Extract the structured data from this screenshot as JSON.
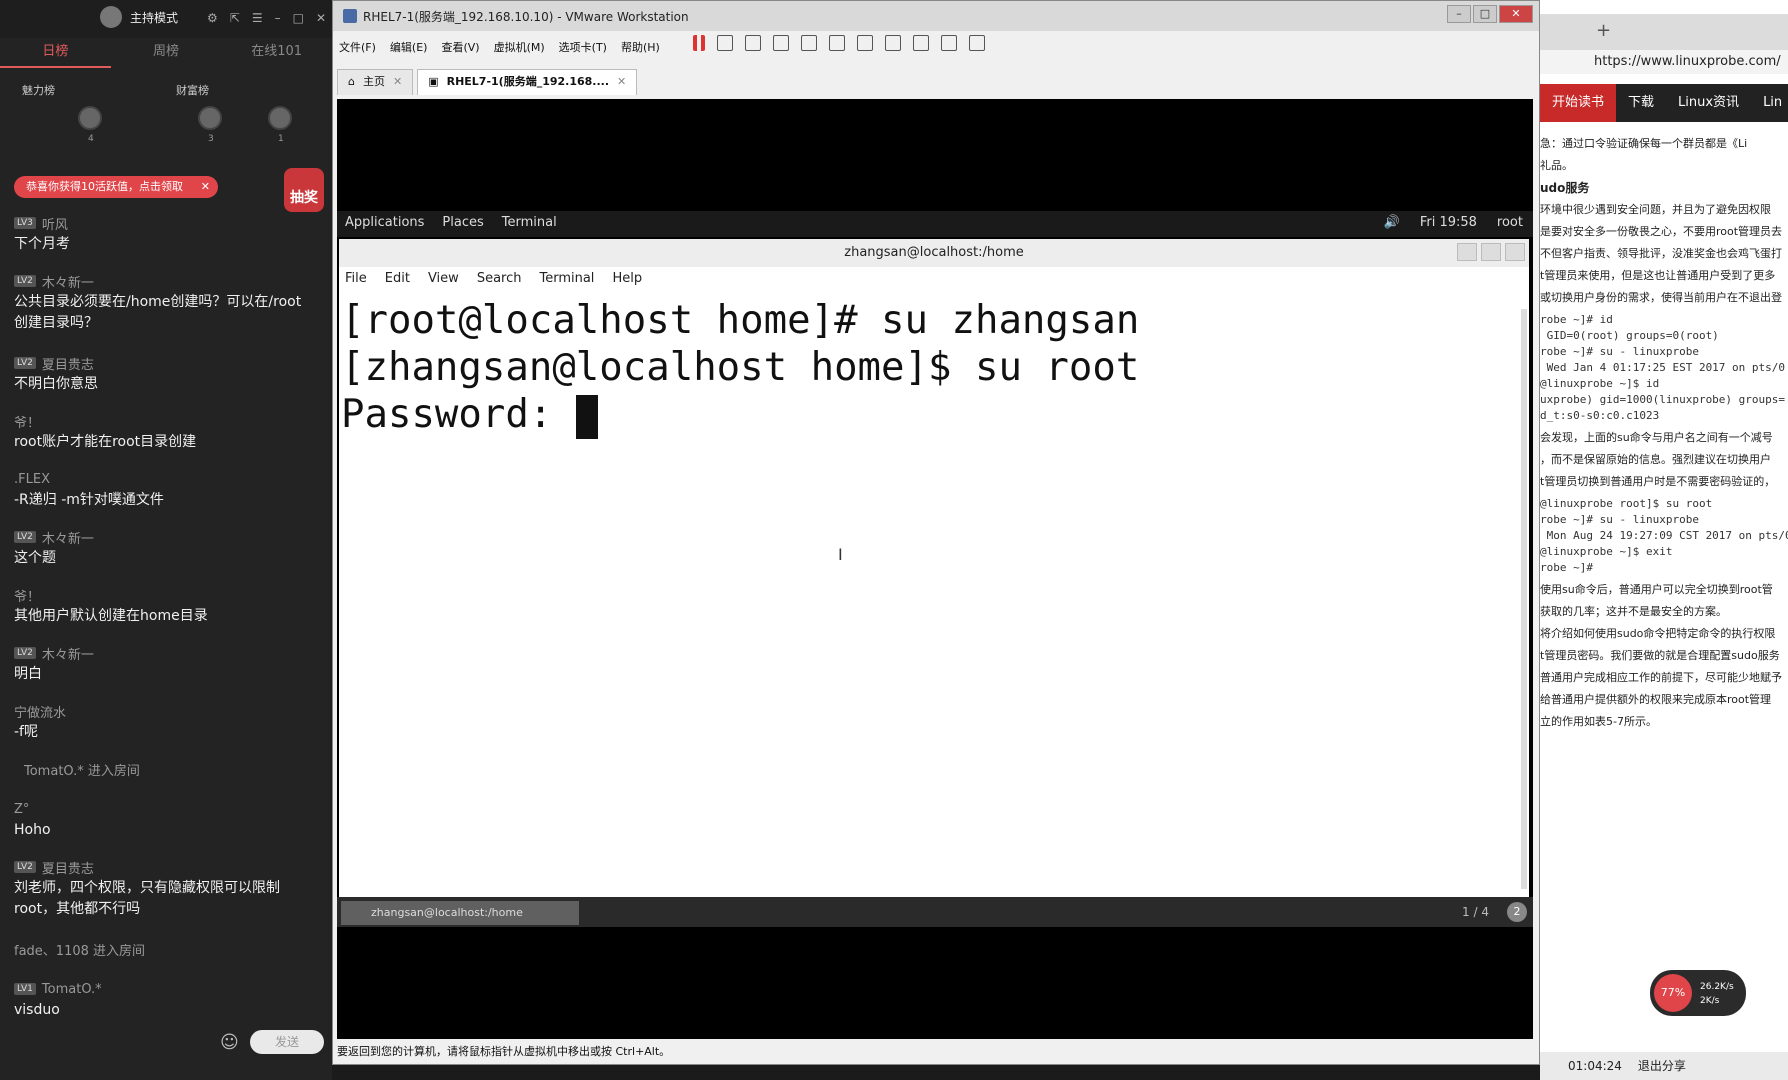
{
  "chat": {
    "host_name": "主持模式",
    "tabs": [
      "日榜",
      "周榜",
      "在线101"
    ],
    "rank_labels": [
      "魅力榜",
      "财富榜"
    ],
    "rank_numbers": [
      "4",
      "3",
      "1"
    ],
    "banner": "恭喜你获得10活跃值，点击领取",
    "lottery": "抽奖",
    "messages": [
      {
        "level": "LV3",
        "user": "听风",
        "text": "下个月考"
      },
      {
        "level": "LV2",
        "user": "木々新一",
        "text": "公共目录必须要在/home创建吗？可以在/root创建目录吗？"
      },
      {
        "level": "LV2",
        "user": "夏目贵志",
        "text": "不明白你意思"
      },
      {
        "level": "",
        "user": "爷！",
        "text": "root账户才能在root目录创建"
      },
      {
        "level": "",
        "user": ".FLEX",
        "text": "-R递归 -m针对噗通文件"
      },
      {
        "level": "LV2",
        "user": "木々新一",
        "text": "这个题"
      },
      {
        "level": "",
        "user": "爷！",
        "text": "其他用户默认创建在home目录"
      },
      {
        "level": "LV2",
        "user": "木々新一",
        "text": "明白"
      },
      {
        "level": "",
        "user": "宁做流水",
        "text": "-f呢"
      }
    ],
    "system1": "TomatO.* 进入房间",
    "messages2": [
      {
        "level": "",
        "user": "Z°",
        "text": "Hoho"
      },
      {
        "level": "LV2",
        "user": "夏目贵志",
        "text": "刘老师，四个权限，只有隐藏权限可以限制root，其他都不行吗"
      }
    ],
    "system2": "fade、1108 进入房间",
    "messages3": [
      {
        "level": "LV1",
        "user": "TomatO.*",
        "text": "visduo"
      }
    ],
    "send_label": "发送"
  },
  "vmware": {
    "title": "RHEL7-1(服务端_192.168.10.10) - VMware Workstation",
    "menu": [
      "文件(F)",
      "编辑(E)",
      "查看(V)",
      "虚拟机(M)",
      "选项卡(T)",
      "帮助(H)"
    ],
    "tabs": [
      {
        "label": "主页"
      },
      {
        "label": "RHEL7-1(服务端_192.168...."
      }
    ],
    "status": "要返回到您的计算机，请将鼠标指针从虚拟机中移出或按 Ctrl+Alt。"
  },
  "gnome": {
    "applications": "Applications",
    "places": "Places",
    "terminal": "Terminal",
    "time": "Fri 19:58",
    "user": "root"
  },
  "terminal": {
    "title": "zhangsan@localhost:/home",
    "menu": [
      "File",
      "Edit",
      "View",
      "Search",
      "Terminal",
      "Help"
    ],
    "lines": [
      "[root@localhost home]# su zhangsan",
      "[zhangsan@localhost home]$ su root",
      "Password: "
    ],
    "taskbar_item": "zhangsan@localhost:/home",
    "page": "1 / 4",
    "badge": "2"
  },
  "browser": {
    "url": "https://www.linuxprobe.com/",
    "nav": [
      "开始读书",
      "下载",
      "Linux资讯",
      "Lin"
    ],
    "texts": [
      "急：通过口令验证确保每一个群员都是《Li",
      "礼品。",
      "udo服务",
      "环境中很少遇到安全问题，并且为了避免因权限",
      "是要对安全多一份敬畏之心，不要用root管理员去",
      "不但客户指责、领导批评，没准奖金也会鸡飞蛋打",
      "t管理员来使用，但是这也让普通用户受到了更多",
      "或切换用户身份的需求，使得当前用户在不退出登",
      "会发现，上面的su命令与用户名之间有一个减号",
      "，而不是保留原始的信息。强烈建议在切换用户",
      "t管理员切换到普通用户时是不需要密码验证的，",
      "使用su命令后，普通用户可以完全切换到root管",
      "获取的几率；这并不是最安全的方案。",
      "将介绍如何使用sudo命令把特定命令的执行权限",
      "t管理员密码。我们要做的就是合理配置sudo服务",
      "普通用户完成相应工作的前提下，尽可能少地赋予",
      "给普通用户提供额外的权限来完成原本root管理",
      "立的作用如表5-7所示。"
    ],
    "code1": [
      "robe ~]# id",
      " GID=0(root) groups=0(root)",
      "robe ~]# su - linuxprobe",
      " Wed Jan 4 01:17:25 EST 2017 on pts/0",
      "@linuxprobe ~]$ id",
      "uxprobe) gid=1000(linuxprobe) groups=",
      "d_t:s0-s0:c0.c1023"
    ],
    "code2": [
      "@linuxprobe root]$ su root",
      "",
      "robe ~]# su - linuxprobe",
      " Mon Aug 24 19:27:09 CST 2017 on pts/0",
      "@linuxprobe ~]$ exit",
      "",
      "robe ~]#"
    ],
    "net_pct": "77%",
    "net_up": "26.2K/s",
    "net_down": "2K/s",
    "footer_time": "01:04:24",
    "footer_share": "退出分享"
  }
}
